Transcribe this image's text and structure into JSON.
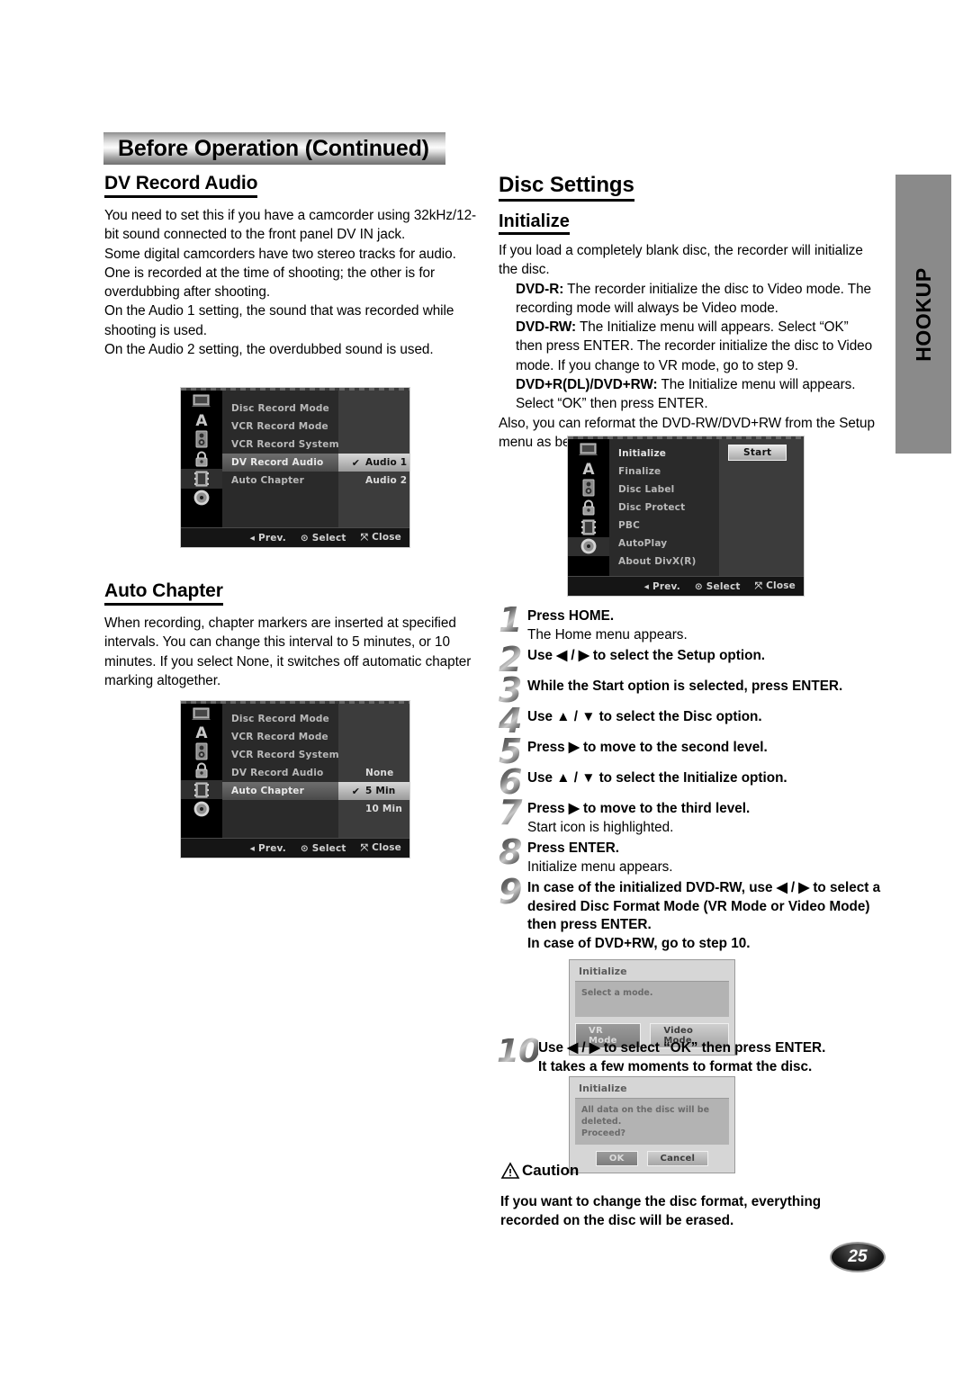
{
  "header": {
    "title": "Before Operation (Continued)"
  },
  "side_tab": {
    "label": "HOOKUP"
  },
  "page_number": "25",
  "left_column": {
    "dv_record_audio": {
      "heading": "DV Record Audio",
      "paragraphs": [
        "You need to set this if you have a camcorder using 32kHz/12-bit sound connected to the front panel DV IN jack.",
        "Some digital camcorders have two stereo tracks for audio. One is recorded at the time of shooting; the other is for overdubbing after shooting.",
        "On the Audio 1 setting, the sound that was recorded while shooting is used.",
        "On the Audio 2 setting, the overdubbed sound is used."
      ]
    },
    "auto_chapter": {
      "heading": "Auto Chapter",
      "paragraphs": [
        "When recording, chapter markers are inserted at specified intervals. You can change this interval to 5 minutes, or 10 minutes. If you select None, it switches off automatic chapter marking altogether."
      ]
    }
  },
  "right_column": {
    "disc_settings_heading": "Disc Settings",
    "initialize_heading": "Initialize",
    "intro": "If you load a completely blank disc, the recorder will initialize the disc.",
    "disc_types": [
      {
        "label": "DVD-R:",
        "text": " The recorder initialize the disc to Video mode. The recording mode will always be Video mode."
      },
      {
        "label": "DVD-RW:",
        "text": " The Initialize menu will appears. Select “OK” then press ENTER. The recorder initialize the disc to Video mode. If you change to VR mode, go to step 9."
      },
      {
        "label": "DVD+R(DL)/DVD+RW:",
        "text": " The Initialize menu will appears. Select “OK” then press ENTER."
      }
    ],
    "outro": "Also, you can reformat the DVD-RW/DVD+RW from the Setup menu as below."
  },
  "osd_dv_record_audio": {
    "menu_items": [
      "Disc Record Mode",
      "VCR Record Mode",
      "VCR Record System",
      "DV Record Audio",
      "Auto Chapter"
    ],
    "selected_index": 3,
    "options": [
      {
        "label": "Audio 1",
        "checked": true,
        "highlighted": true
      },
      {
        "label": "Audio 2",
        "checked": false,
        "highlighted": false
      }
    ],
    "sidebar_icons": [
      "display-icon",
      "language-icon",
      "audio-icon",
      "lock-icon",
      "recording-icon",
      "disc-icon"
    ],
    "sidebar_selected_index": 4,
    "footer": [
      {
        "icon": "◂",
        "label": "Prev."
      },
      {
        "icon": "⊙",
        "label": "Select"
      },
      {
        "icon": "⤧",
        "label": "Close"
      }
    ]
  },
  "osd_auto_chapter": {
    "menu_items": [
      "Disc Record Mode",
      "VCR Record Mode",
      "VCR Record System",
      "DV Record Audio",
      "Auto Chapter"
    ],
    "selected_index": 4,
    "options": [
      {
        "label": "None",
        "checked": false,
        "highlighted": false
      },
      {
        "label": "5 Min",
        "checked": true,
        "highlighted": true
      },
      {
        "label": "10 Min",
        "checked": false,
        "highlighted": false
      }
    ],
    "sidebar_icons": [
      "display-icon",
      "language-icon",
      "audio-icon",
      "lock-icon",
      "recording-icon",
      "disc-icon"
    ],
    "sidebar_selected_index": 4,
    "footer": [
      {
        "icon": "◂",
        "label": "Prev."
      },
      {
        "icon": "⊙",
        "label": "Select"
      },
      {
        "icon": "⤧",
        "label": "Close"
      }
    ]
  },
  "osd_disc_settings": {
    "menu_items": [
      "Initialize",
      "Finalize",
      "Disc Label",
      "Disc Protect",
      "PBC",
      "AutoPlay",
      "About DivX(R)"
    ],
    "selected_index": 0,
    "start_button": "Start",
    "sidebar_icons": [
      "display-icon",
      "language-icon",
      "audio-icon",
      "lock-icon",
      "recording-icon",
      "disc-icon"
    ],
    "sidebar_selected_index": 5,
    "footer": [
      {
        "icon": "◂",
        "label": "Prev."
      },
      {
        "icon": "⊙",
        "label": "Select"
      },
      {
        "icon": "⤧",
        "label": "Close"
      }
    ]
  },
  "steps": [
    {
      "num": "1",
      "bold": "Press HOME.",
      "normal": "The Home menu appears."
    },
    {
      "num": "2",
      "bold": "Use ◀ / ▶ to select the Setup option.",
      "normal": ""
    },
    {
      "num": "3",
      "bold": "While the Start option is selected, press ENTER.",
      "normal": ""
    },
    {
      "num": "4",
      "bold": "Use ▲ / ▼ to select the Disc option.",
      "normal": ""
    },
    {
      "num": "5",
      "bold": "Press ▶ to move to the second level.",
      "normal": ""
    },
    {
      "num": "6",
      "bold": "Use ▲ / ▼ to select the Initialize option.",
      "normal": ""
    },
    {
      "num": "7",
      "bold": "Press ▶ to move to the third level.",
      "normal": "Start icon is highlighted."
    },
    {
      "num": "8",
      "bold": "Press ENTER.",
      "normal": "Initialize menu appears."
    },
    {
      "num": "9",
      "bold": "In case of the initialized DVD-RW, use ◀ / ▶ to select a desired Disc Format Mode (VR Mode or Video Mode) then press ENTER.\nIn case of DVD+RW, go to step 10.",
      "normal": ""
    },
    {
      "num": "10",
      "bold": "Use ◀ / ▶ to select “OK” then press ENTER.\nIt takes a few moments to format the disc.",
      "normal": ""
    }
  ],
  "dialog_mode": {
    "title": "Initialize",
    "message": "Select a mode.",
    "buttons": [
      {
        "label": "VR Mode",
        "selected": true
      },
      {
        "label": "Video Mode",
        "selected": false
      }
    ]
  },
  "dialog_confirm": {
    "title": "Initialize",
    "message": "All data on the disc will be deleted.\nProceed?",
    "buttons": [
      {
        "label": "OK",
        "selected": true
      },
      {
        "label": "Cancel",
        "selected": false
      }
    ]
  },
  "caution": {
    "heading": "Caution",
    "text": "If you want to change the disc format, everything recorded on the disc will be erased."
  }
}
